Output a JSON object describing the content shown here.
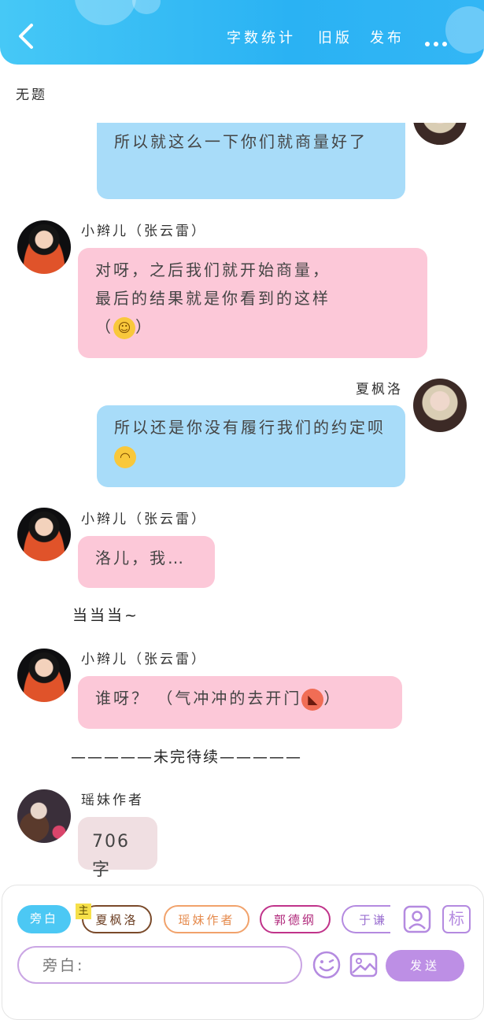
{
  "header": {
    "back_icon": "chevron-left-icon",
    "word_count_label": "字数统计",
    "old_version_label": "旧版",
    "publish_label": "发布",
    "more_icon": "more-dots-icon"
  },
  "document": {
    "title": "无题"
  },
  "messages": [
    {
      "speaker": "",
      "side": "right",
      "text": "所以就这么一下你们就商量好了"
    },
    {
      "speaker": "小辫儿（张云雷）",
      "side": "left",
      "line1": "对呀，之后我们就开始商量，",
      "line2": "最后的结果就是你看到的这样",
      "line3a": "（",
      "emoji": "sweat-smile-emoji",
      "line3b": "）"
    },
    {
      "speaker": "夏枫洛",
      "side": "right",
      "text": "所以还是你没有履行我们的约定呗",
      "emoji": "upside-down-face-emoji"
    },
    {
      "speaker": "小辫儿（张云雷）",
      "side": "left",
      "text": "洛儿，我…"
    },
    {
      "narration": "当当当~"
    },
    {
      "speaker": "小辫儿（张云雷）",
      "side": "left",
      "text": "谁呀？  （气冲冲的去开门",
      "emoji": "angry-face-emoji",
      "text_end": "）"
    },
    {
      "narration": "—————未完待续—————"
    },
    {
      "speaker": "瑶妹作者",
      "side": "left",
      "text": "706字"
    }
  ],
  "toolbar": {
    "roles": [
      {
        "label": "旁白",
        "color": "#4cc8f4",
        "filled": true
      },
      {
        "label": "夏枫洛",
        "color": "#7a4a2a",
        "filled": false,
        "tag": "主"
      },
      {
        "label": "瑶妹作者",
        "color": "#f1a26b",
        "filled": false
      },
      {
        "label": "郭德纲",
        "color": "#c0338a",
        "filled": false
      },
      {
        "label": "于谦",
        "color": "#b48ae0",
        "filled": false
      }
    ],
    "role_manage_icon": "person-card-icon",
    "tag_label": "标",
    "input_placeholder": "旁白:",
    "emoji_icon": "smile-icon",
    "image_icon": "image-icon",
    "send_label": "发送",
    "accent": "#bd8fe5"
  }
}
